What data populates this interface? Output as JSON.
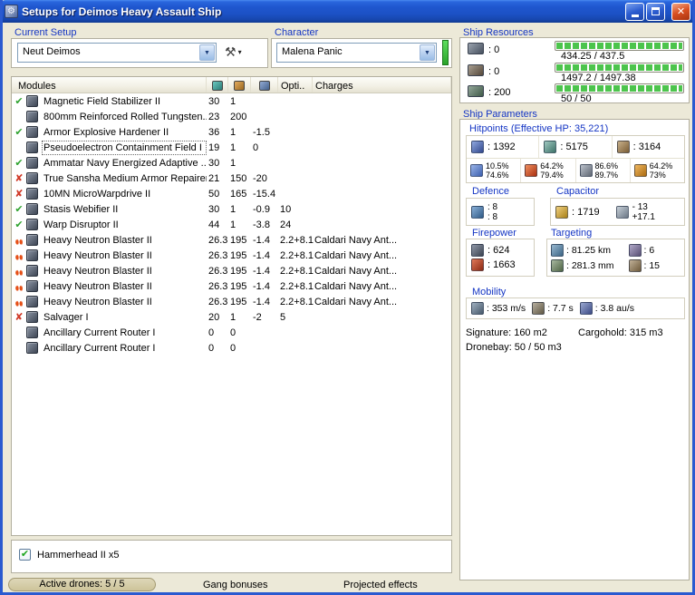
{
  "window": {
    "title": "Setups for Deimos Heavy Assault Ship"
  },
  "icons": {
    "app": "⚙",
    "close": "✕",
    "combo_arrow": "▼",
    "tool": "⚒",
    "tool_arrow": "▾",
    "check": "✔",
    "cross": "✘",
    "checkbox_check": "✔"
  },
  "setup": {
    "label": "Current Setup",
    "value": "Neut Deimos"
  },
  "character": {
    "label": "Character",
    "value": "Malena Panic"
  },
  "resources": {
    "label": "Ship Resources",
    "rows": [
      {
        "icon": "turret-hardpoint-icon",
        "value": ": 0",
        "bar_text": "434.25 / 437.5"
      },
      {
        "icon": "launcher-hardpoint-icon",
        "value": ": 0",
        "bar_text": "1497.2 / 1497.38"
      },
      {
        "icon": "calibration-icon",
        "value": ": 200",
        "bar_text": "50 / 50"
      }
    ]
  },
  "modules": {
    "title": "Modules",
    "header": {
      "opti": "Opti..",
      "charges": "Charges"
    },
    "rows": [
      {
        "status": "check",
        "name": "Magnetic Field Stabilizer II",
        "cpu": "30",
        "pg": "1",
        "cap": "",
        "opti": "",
        "charges": ""
      },
      {
        "status": "none",
        "name": "800mm Reinforced Rolled Tungsten...",
        "cpu": "23",
        "pg": "200",
        "cap": "",
        "opti": "",
        "charges": ""
      },
      {
        "status": "check",
        "name": "Armor Explosive Hardener II",
        "cpu": "36",
        "pg": "1",
        "cap": "-1.5",
        "opti": "",
        "charges": ""
      },
      {
        "status": "none",
        "name": "Pseudoelectron Containment Field I",
        "cpu": "19",
        "pg": "1",
        "cap": "0",
        "opti": "",
        "charges": "",
        "selected": true
      },
      {
        "status": "check",
        "name": "Ammatar Navy Energized Adaptive ...",
        "cpu": "30",
        "pg": "1",
        "cap": "",
        "opti": "",
        "charges": ""
      },
      {
        "status": "cross",
        "name": "True Sansha Medium Armor Repairer",
        "cpu": "21",
        "pg": "150",
        "cap": "-20",
        "opti": "",
        "charges": ""
      },
      {
        "status": "cross",
        "name": "10MN MicroWarpdrive II",
        "cpu": "50",
        "pg": "165",
        "cap": "-15.4",
        "opti": "",
        "charges": ""
      },
      {
        "status": "check",
        "name": "Stasis Webifier II",
        "cpu": "30",
        "pg": "1",
        "cap": "-0.9",
        "opti": "10",
        "charges": ""
      },
      {
        "status": "check",
        "name": "Warp Disruptor II",
        "cpu": "44",
        "pg": "1",
        "cap": "-3.8",
        "opti": "24",
        "charges": ""
      },
      {
        "status": "heat",
        "name": "Heavy Neutron Blaster II",
        "cpu": "26.3",
        "pg": "195",
        "cap": "-1.4",
        "opti": "2.2+8.1",
        "charges": "Caldari Navy Ant..."
      },
      {
        "status": "heat",
        "name": "Heavy Neutron Blaster II",
        "cpu": "26.3",
        "pg": "195",
        "cap": "-1.4",
        "opti": "2.2+8.1",
        "charges": "Caldari Navy Ant..."
      },
      {
        "status": "heat",
        "name": "Heavy Neutron Blaster II",
        "cpu": "26.3",
        "pg": "195",
        "cap": "-1.4",
        "opti": "2.2+8.1",
        "charges": "Caldari Navy Ant..."
      },
      {
        "status": "heat",
        "name": "Heavy Neutron Blaster II",
        "cpu": "26.3",
        "pg": "195",
        "cap": "-1.4",
        "opti": "2.2+8.1",
        "charges": "Caldari Navy Ant..."
      },
      {
        "status": "heat",
        "name": "Heavy Neutron Blaster II",
        "cpu": "26.3",
        "pg": "195",
        "cap": "-1.4",
        "opti": "2.2+8.1",
        "charges": "Caldari Navy Ant..."
      },
      {
        "status": "cross",
        "name": "Salvager I",
        "cpu": "20",
        "pg": "1",
        "cap": "-2",
        "opti": "5",
        "charges": ""
      },
      {
        "status": "none",
        "name": "Ancillary Current Router I",
        "cpu": "0",
        "pg": "0",
        "cap": "",
        "opti": "",
        "charges": ""
      },
      {
        "status": "none",
        "name": "Ancillary Current Router I",
        "cpu": "0",
        "pg": "0",
        "cap": "",
        "opti": "",
        "charges": ""
      }
    ]
  },
  "parameters": {
    "label": "Ship Parameters",
    "hitpoints": {
      "label": "Hitpoints (Effective HP: 35,221)",
      "shield": ": 1392",
      "armor": ": 5175",
      "structure": ": 3164",
      "resists": [
        {
          "top": "10.5%",
          "bottom": "74.6%"
        },
        {
          "top": "64.2%",
          "bottom": "79.4%"
        },
        {
          "top": "86.6%",
          "bottom": "89.7%"
        },
        {
          "top": "64.2%",
          "bottom": "73%"
        }
      ]
    },
    "defence": {
      "label": "Defence",
      "v1": ": 8",
      "v2": ": 8"
    },
    "capacitor": {
      "label": "Capacitor",
      "amount": ": 1719",
      "delta_top": "- 13",
      "delta_bottom": "+17.1"
    },
    "firepower": {
      "label": "Firepower",
      "volley": ": 624",
      "dps": ": 1663"
    },
    "targeting": {
      "label": "Targeting",
      "range": ": 81.25 km",
      "max_targets": ": 6",
      "scan_res": ": 281.3 mm",
      "sensor": ": 15"
    },
    "mobility": {
      "label": "Mobility",
      "speed": ": 353 m/s",
      "align": ": 7.7 s",
      "warp": ": 3.8 au/s"
    },
    "signature": "Signature: 160 m2",
    "cargohold": "Cargohold: 315 m3",
    "dronebay": "Dronebay: 50 / 50 m3"
  },
  "drones": {
    "items": [
      {
        "name": "Hammerhead II x5",
        "checked": true
      }
    ]
  },
  "statusbar": {
    "active_drones": "Active drones: 5 / 5",
    "gang_bonuses": "Gang bonuses",
    "projected_effects": "Projected effects"
  },
  "colors": {
    "accent_blue": "#1536c4",
    "check_green": "#2fa32f",
    "cross_red": "#d03a28",
    "heat_orange": "#e55018",
    "bar_green": "#4cc44c"
  }
}
